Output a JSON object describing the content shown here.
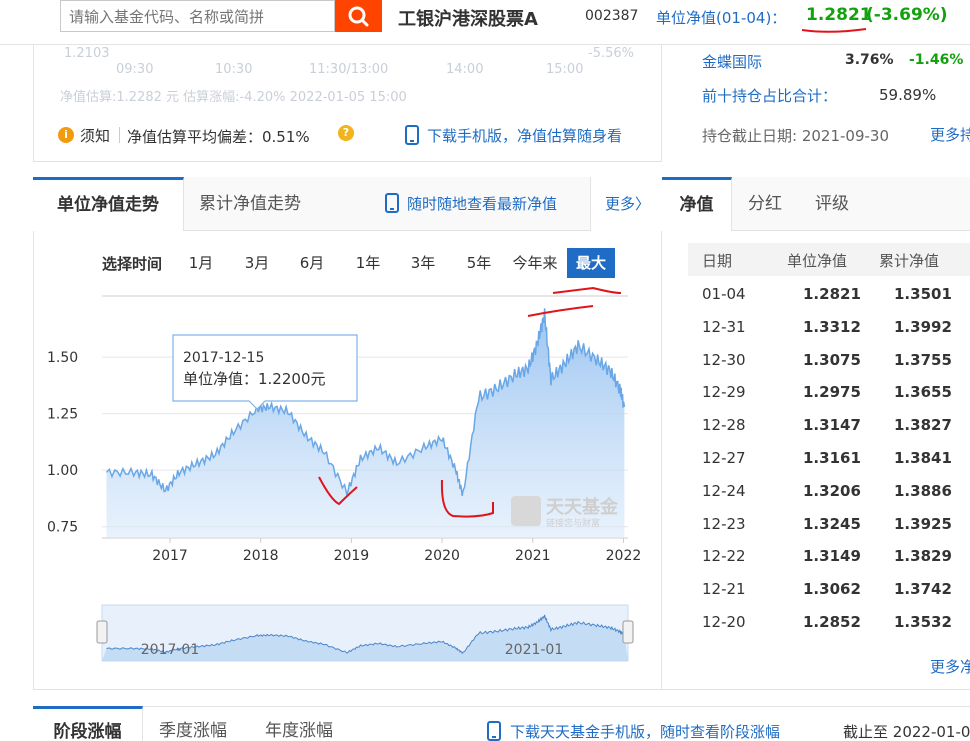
{
  "header": {
    "search_placeholder": "请输入基金代码、名称或简拼",
    "fund_name": "工银沪港深股票A",
    "fund_code": "002387",
    "nav_label": "单位净值(01-04)：",
    "nav_value": "1.2821",
    "nav_change": "(-3.69%)"
  },
  "estimate_panel": {
    "faded_value": "1.2103",
    "faded_pct": "-5.56%",
    "faded_times": [
      "09:30",
      "10:30",
      "11:30/13:00",
      "14:00",
      "15:00"
    ],
    "faded_line": "净值估算:1.2282 元  估算涨幅:-4.20% 2022-01-05 15:00",
    "notice_label": "须知",
    "deviation_text": "净值估算平均偏差：0.51%",
    "download_text": "下载手机版，净值估算随身看"
  },
  "holdings": {
    "name": "金蝶国际",
    "pct": "3.76%",
    "change": "-1.46%",
    "top10_label": "前十持仓占比合计：",
    "top10_value": "59.89%",
    "asof": "持仓截止日期: 2021-09-30",
    "more": "更多持"
  },
  "chart_tabs": {
    "active": "单位净值走势",
    "second": "累计净值走势",
    "mobile": "随时随地查看最新净值",
    "more": "更多〉"
  },
  "range": {
    "label": "选择时间",
    "options": [
      "1月",
      "3月",
      "6月",
      "1年",
      "3年",
      "5年",
      "今年来",
      "最大"
    ],
    "active": "最大"
  },
  "chart_data": {
    "type": "area",
    "series_name": "单位净值",
    "x_ticks": [
      "2017",
      "2018",
      "2019",
      "2020",
      "2021",
      "2022"
    ],
    "y_ticks": [
      "1.50",
      "1.25",
      "1.00",
      "0.75"
    ],
    "ylim": [
      0.7,
      1.77
    ],
    "x": [
      2016.3,
      2016.6,
      2016.8,
      2016.95,
      2017.1,
      2017.3,
      2017.5,
      2017.7,
      2017.96,
      2018.1,
      2018.3,
      2018.5,
      2018.7,
      2018.95,
      2019.1,
      2019.3,
      2019.5,
      2019.8,
      2020.0,
      2020.15,
      2020.23,
      2020.4,
      2020.6,
      2020.8,
      2020.95,
      2021.05,
      2021.13,
      2021.2,
      2021.35,
      2021.5,
      2021.7,
      2021.85,
      2021.96,
      2022.01
    ],
    "values": [
      0.99,
      0.99,
      0.98,
      0.91,
      0.99,
      1.03,
      1.07,
      1.17,
      1.27,
      1.28,
      1.26,
      1.15,
      1.08,
      0.9,
      1.05,
      1.1,
      1.03,
      1.1,
      1.14,
      1.0,
      0.89,
      1.32,
      1.36,
      1.42,
      1.45,
      1.56,
      1.69,
      1.4,
      1.47,
      1.55,
      1.49,
      1.44,
      1.36,
      1.28
    ],
    "tooltip": {
      "date": "2017-12-15",
      "label": "单位净值：",
      "value": "1.2200元"
    },
    "navigator_labels": [
      "2017-01",
      "2021-01"
    ],
    "watermark": "天天基金",
    "watermark_sub": "链接您与财富"
  },
  "nav_tabs": {
    "active": "净值",
    "second": "分红",
    "third": "评级"
  },
  "nav_table": {
    "headers": [
      "日期",
      "单位净值",
      "累计净值"
    ],
    "rows": [
      [
        "01-04",
        "1.2821",
        "1.3501"
      ],
      [
        "12-31",
        "1.3312",
        "1.3992"
      ],
      [
        "12-30",
        "1.3075",
        "1.3755"
      ],
      [
        "12-29",
        "1.2975",
        "1.3655"
      ],
      [
        "12-28",
        "1.3147",
        "1.3827"
      ],
      [
        "12-27",
        "1.3161",
        "1.3841"
      ],
      [
        "12-24",
        "1.3206",
        "1.3886"
      ],
      [
        "12-23",
        "1.3245",
        "1.3925"
      ],
      [
        "12-22",
        "1.3149",
        "1.3829"
      ],
      [
        "12-21",
        "1.3062",
        "1.3742"
      ],
      [
        "12-20",
        "1.2852",
        "1.3532"
      ]
    ],
    "more": "更多净"
  },
  "bottom": {
    "tabs": [
      "阶段涨幅",
      "季度涨幅",
      "年度涨幅"
    ],
    "download": "下载天天基金手机版，随时查看阶段涨幅",
    "asof_label": "截止至",
    "asof_date": "2022-01-0"
  },
  "colors": {
    "accent": "#1f6cc4",
    "up_green": "#13a10e",
    "search_orange": "#ff4400",
    "area_fill": "#a9cdf2",
    "annotation_red": "#e0141c"
  }
}
